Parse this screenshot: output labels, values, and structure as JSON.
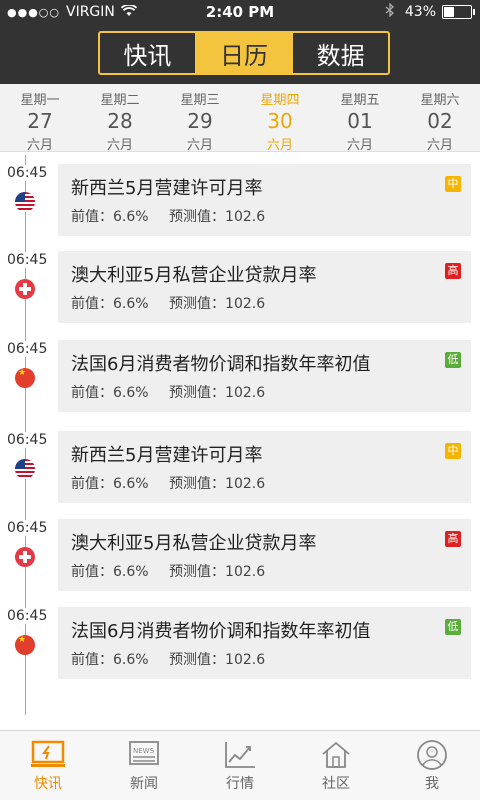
{
  "status_bar": {
    "signal_dots": "●●●○○",
    "carrier": "VIRGIN",
    "time": "2:40 PM",
    "bluetooth_icon": "bluetooth-icon",
    "battery": "43%",
    "battery_level": 0.43
  },
  "segments": [
    {
      "label": "快讯",
      "active": false
    },
    {
      "label": "日历",
      "active": true
    },
    {
      "label": "数据",
      "active": false
    }
  ],
  "week": [
    {
      "weekday": "星期一",
      "date": "27",
      "month": "六月",
      "active": false
    },
    {
      "weekday": "星期二",
      "date": "28",
      "month": "六月",
      "active": false
    },
    {
      "weekday": "星期三",
      "date": "29",
      "month": "六月",
      "active": false
    },
    {
      "weekday": "星期四",
      "date": "30",
      "month": "六月",
      "active": true
    },
    {
      "weekday": "星期五",
      "date": "01",
      "month": "六月",
      "active": false
    },
    {
      "weekday": "星期六",
      "date": "02",
      "month": "六月",
      "active": false
    }
  ],
  "events": [
    {
      "time": "06:45",
      "flag": "us-flag-icon",
      "title": "新西兰5月营建许可月率",
      "prev": "前值：6.6%",
      "forecast": "预测值：102.6",
      "importance": "中",
      "importance_color": "#f5b400"
    },
    {
      "time": "06:45",
      "flag": "swiss-flag-icon",
      "title": "澳大利亚5月私营企业贷款月率",
      "prev": "前值：6.6%",
      "forecast": "预测值：102.6",
      "importance": "高",
      "importance_color": "#e02020"
    },
    {
      "time": "06:45",
      "flag": "china-flag-icon",
      "title": "法国6月消费者物价调和指数年率初值",
      "prev": "前值：6.6%",
      "forecast": "预测值：102.6",
      "importance": "低",
      "importance_color": "#5aad3a"
    },
    {
      "time": "06:45",
      "flag": "us-flag-icon",
      "title": "新西兰5月营建许可月率",
      "prev": "前值：6.6%",
      "forecast": "预测值：102.6",
      "importance": "中",
      "importance_color": "#f5b400"
    },
    {
      "time": "06:45",
      "flag": "swiss-flag-icon",
      "title": "澳大利亚5月私营企业贷款月率",
      "prev": "前值：6.6%",
      "forecast": "预测值：102.6",
      "importance": "高",
      "importance_color": "#e02020"
    },
    {
      "time": "06:45",
      "flag": "china-flag-icon",
      "title": "法国6月消费者物价调和指数年率初值",
      "prev": "前值：6.6%",
      "forecast": "预测值：102.6",
      "importance": "低",
      "importance_color": "#5aad3a"
    }
  ],
  "tabbar": [
    {
      "label": "快讯",
      "icon": "monitor-icon",
      "active": true
    },
    {
      "label": "新闻",
      "icon": "news-icon",
      "active": false
    },
    {
      "label": "行情",
      "icon": "chart-icon",
      "active": false
    },
    {
      "label": "社区",
      "icon": "house-icon",
      "active": false
    },
    {
      "label": "我",
      "icon": "profile-icon",
      "active": false
    }
  ],
  "colors": {
    "header_bg": "#333333",
    "accent": "#f5c43f",
    "active_tab": "#f08a00",
    "timeline": "#5bc0d8"
  }
}
